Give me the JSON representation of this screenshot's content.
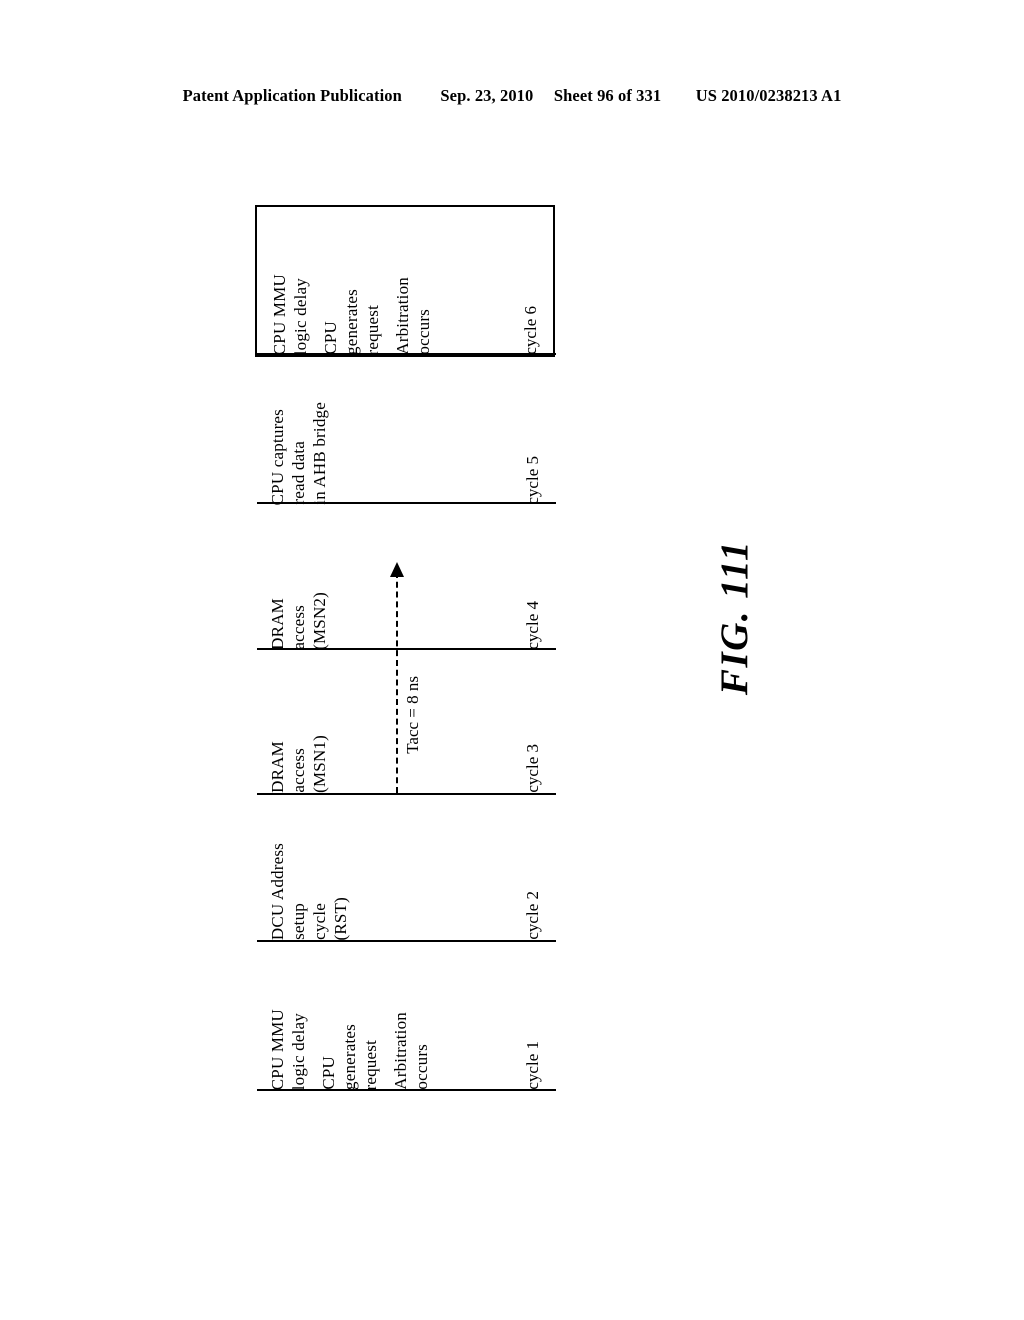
{
  "header": {
    "publication": "Patent Application Publication",
    "date": "Sep. 23, 2010",
    "sheet": "Sheet 96 of 331",
    "patent_number": "US 2010/0238213 A1"
  },
  "figure": {
    "label": "FIG. 111",
    "orientation": "rotated-90-ccw",
    "annotation": {
      "tacc_label": "Tacc = 8 ns"
    },
    "cycles": [
      {
        "id": "cycle-1",
        "label": "cycle 1",
        "boxed": false,
        "groups": [
          {
            "lines": [
              "CPU MMU",
              "logic delay"
            ]
          },
          {
            "lines": [
              "CPU",
              "generates",
              "request"
            ]
          },
          {
            "lines": [
              "Arbitration",
              "occurs"
            ]
          }
        ]
      },
      {
        "id": "cycle-2",
        "label": "cycle 2",
        "boxed": false,
        "groups": [
          {
            "lines": [
              "DCU Address",
              "setup",
              "cycle",
              "(RST)"
            ]
          }
        ]
      },
      {
        "id": "cycle-3",
        "label": "cycle 3",
        "boxed": false,
        "groups": [
          {
            "lines": [
              "DRAM",
              "access",
              "(MSN1)"
            ]
          }
        ]
      },
      {
        "id": "cycle-4",
        "label": "cycle 4",
        "boxed": false,
        "groups": [
          {
            "lines": [
              "DRAM",
              "access",
              "(MSN2)"
            ]
          }
        ]
      },
      {
        "id": "cycle-5",
        "label": "cycle 5",
        "boxed": false,
        "groups": [
          {
            "lines": [
              "CPU  captures",
              "read data",
              "in AHB bridge"
            ]
          }
        ]
      },
      {
        "id": "cycle-6",
        "label": "cycle 6",
        "boxed": true,
        "groups": [
          {
            "lines": [
              "CPU MMU",
              "logic delay"
            ]
          },
          {
            "lines": [
              "CPU",
              "generates",
              "request"
            ]
          },
          {
            "lines": [
              "Arbitration",
              "occurs"
            ]
          }
        ]
      }
    ]
  },
  "colors": {
    "ink": "#000000",
    "paper": "#ffffff"
  }
}
